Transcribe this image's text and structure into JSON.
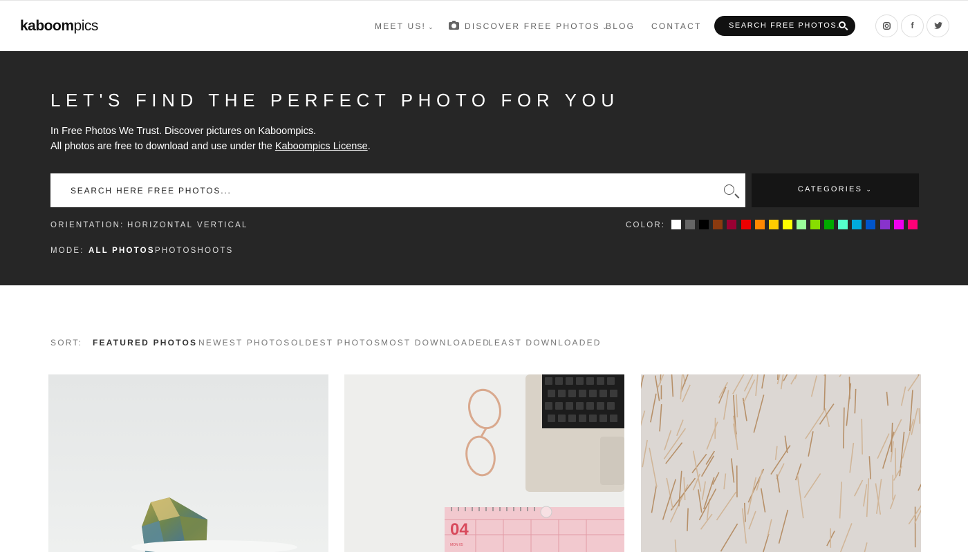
{
  "header": {
    "logo_bold": "kaboom",
    "logo_light": "pics",
    "nav": [
      {
        "label": "MEET US!",
        "has_dropdown": true
      },
      {
        "label": "DISCOVER FREE PHOTOS",
        "has_dropdown": true,
        "icon": "camera-icon"
      },
      {
        "label": "BLOG"
      },
      {
        "label": "CONTACT"
      }
    ],
    "search_label": "SEARCH FREE PHOTOS...",
    "social": [
      "instagram-icon",
      "facebook-icon",
      "twitter-icon"
    ],
    "social_glyphs": {
      "facebook": "f"
    }
  },
  "hero": {
    "title": "LET'S FIND THE PERFECT PHOTO FOR YOU",
    "line1": "In Free Photos We Trust. Discover pictures on Kaboompics.",
    "line2_prefix": "All photos are free to download and use under the ",
    "line2_link": "Kaboompics License",
    "line2_suffix": ".",
    "search_placeholder": "SEARCH HERE FREE PHOTOS...",
    "categories_label": "CATEGORIES",
    "orientation_label": "ORIENTATION:",
    "orientation_options": [
      "HORIZONTAL",
      "VERTICAL"
    ],
    "mode_label": "MODE:",
    "mode_options": [
      {
        "label": "ALL PHOTOS",
        "active": true
      },
      {
        "label": "PHOTOSHOOTS",
        "active": false
      }
    ],
    "color_label": "COLOR:",
    "colors": [
      "#ffffff",
      "#666666",
      "#000000",
      "#8b3a0f",
      "#990033",
      "#ee0000",
      "#ff8800",
      "#ffcc00",
      "#ffff00",
      "#99ff99",
      "#88dd00",
      "#00aa00",
      "#55ffcc",
      "#00aadd",
      "#0055cc",
      "#8833cc",
      "#ee00ee",
      "#ff0077"
    ]
  },
  "sort": {
    "label": "SORT:",
    "options": [
      {
        "label": "FEATURED PHOTOS",
        "active": true
      },
      {
        "label": "NEWEST PHOTOS",
        "active": false
      },
      {
        "label": "OLDEST PHOTOS",
        "active": false
      },
      {
        "label": "MOST DOWNLOADED",
        "active": false
      },
      {
        "label": "LEAST DOWNLOADED",
        "active": false
      }
    ]
  },
  "photos": [
    {
      "subject": "glass prism on white"
    },
    {
      "subject": "laptop, glasses and pink calendar",
      "calendar_day": "04",
      "calendar_weekday": "MON 05"
    },
    {
      "subject": "dried pampas grass"
    }
  ]
}
